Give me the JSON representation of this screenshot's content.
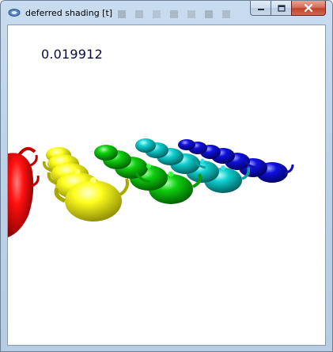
{
  "window": {
    "title": "deferred shading [t]",
    "app_icon": "app-icon",
    "caption_buttons": {
      "minimize_icon": "minimize-icon",
      "maximize_icon": "maximize-icon",
      "close_icon": "close-icon"
    }
  },
  "viewport": {
    "frame_time": "0.019912",
    "scene_description_icon": "teapot-grid",
    "teapot_colors": [
      "#ff0000",
      "#ffff00",
      "#00cc00",
      "#00cccc",
      "#0000cc"
    ]
  }
}
